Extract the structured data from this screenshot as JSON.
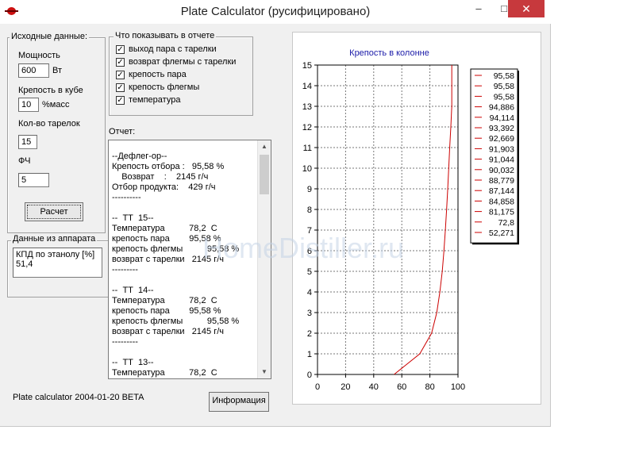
{
  "window": {
    "title": "Plate Calculator (русифицировано)",
    "controls": {
      "minimize": "–",
      "maximize": "□",
      "close": "✕"
    }
  },
  "input_group": {
    "legend": "Исходные данные:",
    "power_label": "Мощность",
    "power_value": "600",
    "power_unit": "Вт",
    "strength_label": "Крепость в кубе",
    "strength_value": "10",
    "strength_unit": "%масс",
    "plates_label": "Кол-во тарелок",
    "plates_value": "15",
    "fch_label": "ФЧ",
    "fch_value": "5",
    "calc_button": "Расчет"
  },
  "device_group": {
    "legend": "Данные из аппарата",
    "lines": [
      "КПД по этанолу [%]",
      "51,4"
    ]
  },
  "report_options": {
    "legend": "Что показывать в отчете",
    "items": [
      {
        "label": "выход пара с тарелки",
        "checked": true
      },
      {
        "label": "возврат флегмы с тарелки",
        "checked": true
      },
      {
        "label": "крепость пара",
        "checked": true
      },
      {
        "label": "крепость флегмы",
        "checked": true
      },
      {
        "label": "температура",
        "checked": true
      }
    ]
  },
  "report": {
    "label": "Отчет:",
    "lines": [
      "--Дефлег-ор--",
      "Крепость отбора :   95,58 %",
      "    Возврат    :    2145 г/ч",
      "Отбор продукта:    429 г/ч",
      "----------",
      "",
      "--  ТТ  15--",
      "Температура          78,2  С",
      "крепость пара        95,58 %",
      "крепость флегмы          95,58 %",
      "возврат с тарелки   2145 г/ч",
      "---------",
      "",
      "--  ТТ  14--",
      "Температура          78,2  С",
      "крепость пара        95,58 %",
      "крепость флегмы          95,58 %",
      "возврат с тарелки   2145 г/ч",
      "---------",
      "",
      "--  ТТ  13--",
      "Температура          78,2  С"
    ]
  },
  "status_text": "Plate calculator 2004-01-20 BETA",
  "info_button": "Информация",
  "watermark": "HomeDistiller.ru",
  "colors": {
    "line": "#cc0000",
    "title": "#1a1aa8",
    "close": "#c7393d"
  },
  "chart_data": {
    "type": "line",
    "title": "Крепость в колонне",
    "xlim": [
      0,
      100
    ],
    "ylim": [
      0,
      15
    ],
    "x_ticks": [
      "0",
      "20",
      "40",
      "60",
      "80",
      "100"
    ],
    "y_ticks": [
      "0",
      "1",
      "2",
      "3",
      "4",
      "5",
      "6",
      "7",
      "8",
      "9",
      "10",
      "11",
      "12",
      "13",
      "14",
      "15"
    ],
    "grid": true,
    "legend_position": "right",
    "legend_entries": [
      "95,58",
      "95,58",
      "95,58",
      "94,886",
      "94,114",
      "93,392",
      "92,669",
      "91,903",
      "91,044",
      "90,032",
      "88,779",
      "87,144",
      "84,858",
      "81,175",
      "72,8",
      "52,271"
    ],
    "series": [
      {
        "x": [
          54.5,
          72.8,
          81.2,
          84.9,
          87.1,
          88.8,
          90.0,
          91.0,
          91.9,
          92.7,
          93.4,
          94.1,
          94.9,
          95.58,
          95.58,
          95.58
        ],
        "y": [
          0,
          1,
          2,
          3,
          4,
          5,
          6,
          7,
          8,
          9,
          10,
          11,
          12,
          13,
          14,
          15
        ]
      }
    ]
  }
}
